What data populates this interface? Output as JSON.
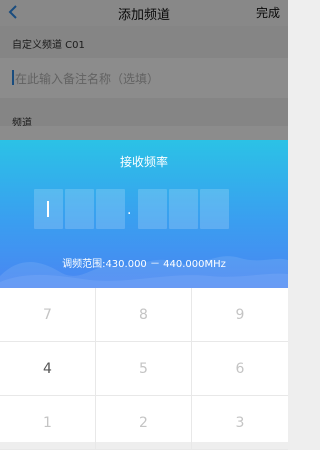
{
  "navbar": {
    "title": "添加频道",
    "done_label": "完成",
    "back_icon": "chevron-left-icon"
  },
  "form": {
    "custom_channel_label": "自定义频道 C01",
    "name_placeholder": "在此输入备注名称（选填）",
    "channel_label": "频道"
  },
  "modal": {
    "title": "接收频率",
    "decimal_separator": ".",
    "range_text": "调频范围:430.000 － 440.000MHz",
    "accent_colors": [
      "#2bc2e6",
      "#4a86f2"
    ]
  },
  "keypad": {
    "keys": [
      "7",
      "8",
      "9",
      "4",
      "5",
      "6",
      "1",
      "2",
      "3"
    ]
  }
}
